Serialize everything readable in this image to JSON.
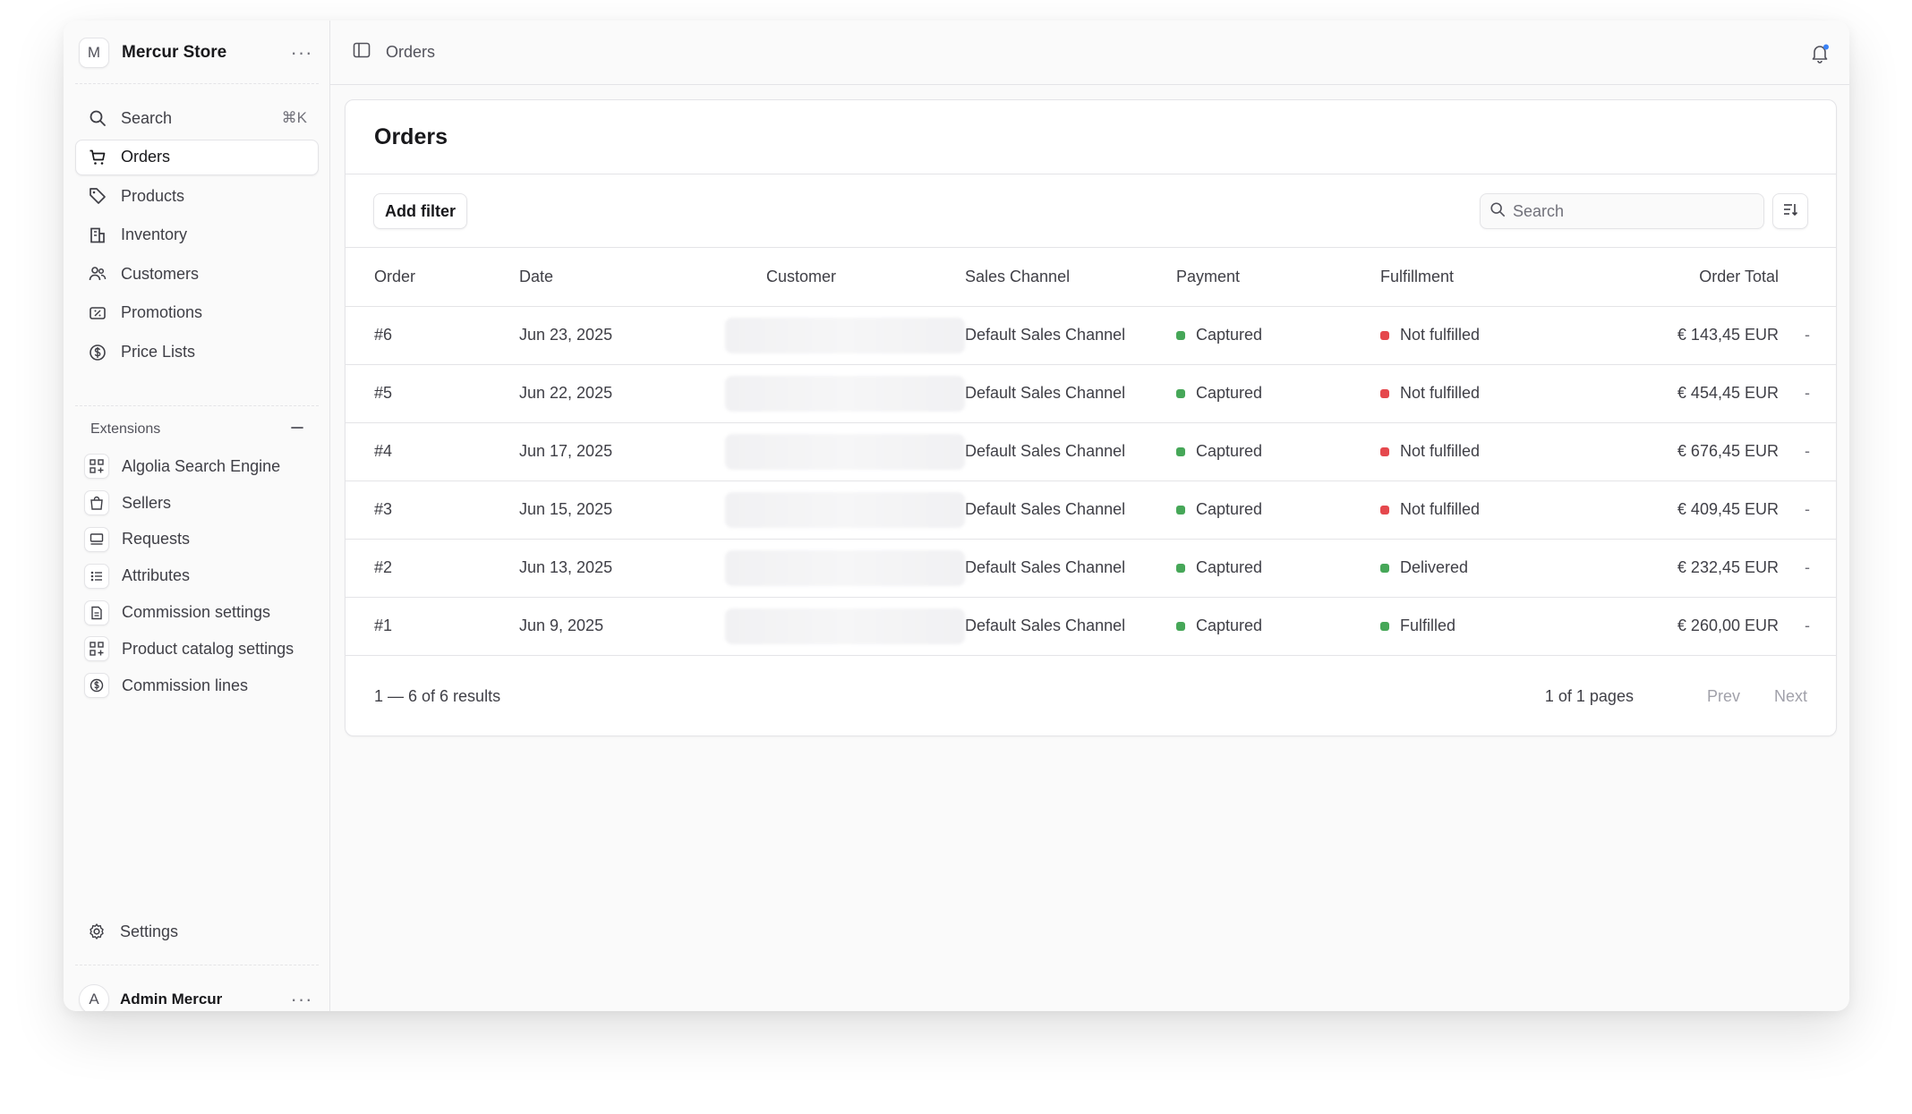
{
  "store": {
    "avatar": "M",
    "name": "Mercur Store",
    "menu": "···"
  },
  "nav": [
    {
      "label": "Search",
      "shortcut": "⌘K",
      "icon": "search-icon"
    },
    {
      "label": "Orders",
      "icon": "cart-icon",
      "active": true
    },
    {
      "label": "Products",
      "icon": "tag-icon"
    },
    {
      "label": "Inventory",
      "icon": "building-icon"
    },
    {
      "label": "Customers",
      "icon": "users-icon"
    },
    {
      "label": "Promotions",
      "icon": "receipt-percent-icon"
    },
    {
      "label": "Price Lists",
      "icon": "currency-icon"
    }
  ],
  "extensions": {
    "heading": "Extensions",
    "items": [
      {
        "label": "Algolia Search Engine",
        "icon": "squares-plus-icon"
      },
      {
        "label": "Sellers",
        "icon": "shopping-bag-icon"
      },
      {
        "label": "Requests",
        "icon": "server-icon"
      },
      {
        "label": "Attributes",
        "icon": "checklist-icon"
      },
      {
        "label": "Commission settings",
        "icon": "document-icon"
      },
      {
        "label": "Product catalog settings",
        "icon": "squares-plus-icon"
      },
      {
        "label": "Commission lines",
        "icon": "currency-icon"
      }
    ]
  },
  "settings": {
    "label": "Settings"
  },
  "user": {
    "avatar": "A",
    "name": "Admin Mercur",
    "menu": "···"
  },
  "topbar": {
    "breadcrumb": "Orders"
  },
  "page": {
    "title": "Orders",
    "add_filter": "Add filter",
    "search_placeholder": "Search"
  },
  "table": {
    "columns": [
      "Order",
      "Date",
      "Customer",
      "Sales Channel",
      "Payment",
      "Fulfillment",
      "Order Total"
    ],
    "rows": [
      {
        "order": "#6",
        "date": "Jun 23, 2025",
        "channel": "Default Sales Channel",
        "payment": "Captured",
        "fulfillment": "Not fulfilled",
        "fulfillment_color": "#e5484d",
        "total": "€ 143,45 EUR",
        "action": "-"
      },
      {
        "order": "#5",
        "date": "Jun 22, 2025",
        "channel": "Default Sales Channel",
        "payment": "Captured",
        "fulfillment": "Not fulfilled",
        "fulfillment_color": "#e5484d",
        "total": "€ 454,45 EUR",
        "action": "-"
      },
      {
        "order": "#4",
        "date": "Jun 17, 2025",
        "channel": "Default Sales Channel",
        "payment": "Captured",
        "fulfillment": "Not fulfilled",
        "fulfillment_color": "#e5484d",
        "total": "€ 676,45 EUR",
        "action": "-"
      },
      {
        "order": "#3",
        "date": "Jun 15, 2025",
        "channel": "Default Sales Channel",
        "payment": "Captured",
        "fulfillment": "Not fulfilled",
        "fulfillment_color": "#e5484d",
        "total": "€ 409,45 EUR",
        "action": "-"
      },
      {
        "order": "#2",
        "date": "Jun 13, 2025",
        "channel": "Default Sales Channel",
        "payment": "Captured",
        "fulfillment": "Delivered",
        "fulfillment_color": "#46a758",
        "total": "€ 232,45 EUR",
        "action": "-"
      },
      {
        "order": "#1",
        "date": "Jun 9, 2025",
        "channel": "Default Sales Channel",
        "payment": "Captured",
        "fulfillment": "Fulfilled",
        "fulfillment_color": "#46a758",
        "total": "€ 260,00 EUR",
        "action": "-"
      }
    ]
  },
  "pagination": {
    "summary": "1 — 6 of 6 results",
    "pages": "1 of 1 pages",
    "prev": "Prev",
    "next": "Next"
  },
  "colors": {
    "captured": "#46a758",
    "not_fulfilled": "#e5484d",
    "accent": "#3b82f6"
  }
}
